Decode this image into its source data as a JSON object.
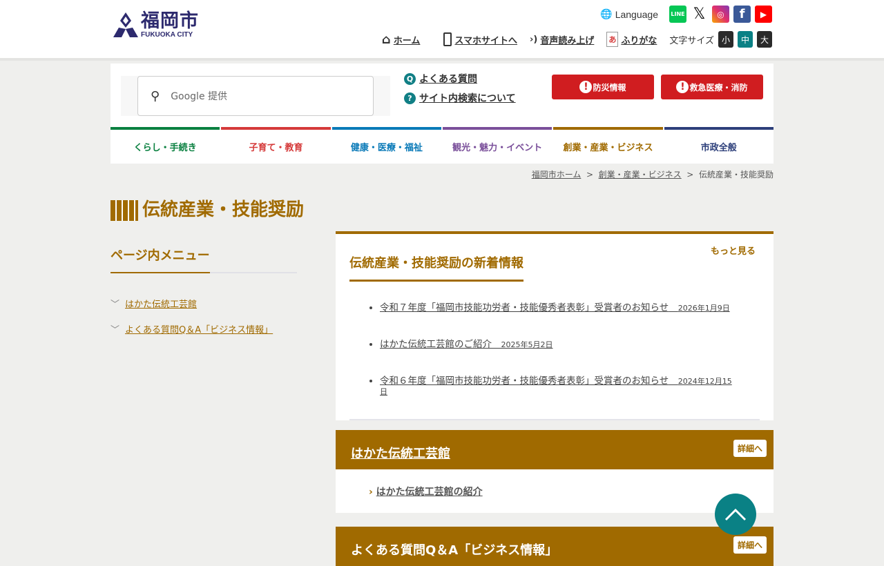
{
  "logo": {
    "kanji": "福岡市",
    "roman": "FUKUOKA CITY"
  },
  "header": {
    "language": "Language",
    "sns": [
      "LINE",
      "X",
      "Instagram",
      "Facebook",
      "YouTube"
    ],
    "nav": {
      "home": "ホーム",
      "mobile": "スマホサイトへ",
      "voice": "音声読み上げ",
      "furigana": "ふりがな",
      "text_size": "文字サイズ",
      "sizes": [
        "小",
        "中",
        "大"
      ]
    }
  },
  "search": {
    "placeholder": "Google 提供",
    "faq": "よくある質問",
    "about": "サイト内検索について"
  },
  "emergency": {
    "disaster": "防災情報",
    "medical": "救急医療・消防"
  },
  "gnav": [
    {
      "label": "くらし・手続き",
      "color": "#0a8040"
    },
    {
      "label": "子育て・教育",
      "color": "#d53a3a"
    },
    {
      "label": "健康・医療・福祉",
      "color": "#0a7ab8"
    },
    {
      "label": "観光・魅力・イベント",
      "color": "#7a4f9a"
    },
    {
      "label": "創業・産業・ビジネス",
      "color": "#a06a00"
    },
    {
      "label": "市政全般",
      "color": "#2d3f7a"
    }
  ],
  "breadcrumb": [
    "福岡市ホーム",
    "創業・産業・ビジネス",
    "伝統産業・技能奨励"
  ],
  "page_title": "伝統産業・技能奨励",
  "page_menu": {
    "title": "ページ内メニュー",
    "items": [
      "はかた伝統工芸館",
      "よくある質問Q＆A「ビジネス情報」"
    ]
  },
  "news": {
    "title": "伝統産業・技能奨励の新着情報",
    "more": "もっと見る",
    "items": [
      {
        "text": "令和７年度「福岡市技能功労者・技能優秀者表彰」受賞者のお知らせ",
        "date": "2026年1月9日"
      },
      {
        "text": "はかた伝統工芸館のご紹介",
        "date": "2025年5月2日"
      },
      {
        "text": "令和６年度「福岡市技能功労者・技能優秀者表彰」受賞者のお知らせ",
        "date": "2024年12月15日"
      }
    ]
  },
  "sections": [
    {
      "title": "はかた伝統工芸館",
      "detail": "詳細へ",
      "links": [
        "はかた伝統工芸館の紹介"
      ]
    },
    {
      "title": "よくある質問Q＆A「ビジネス情報」",
      "detail": "詳細へ"
    }
  ]
}
